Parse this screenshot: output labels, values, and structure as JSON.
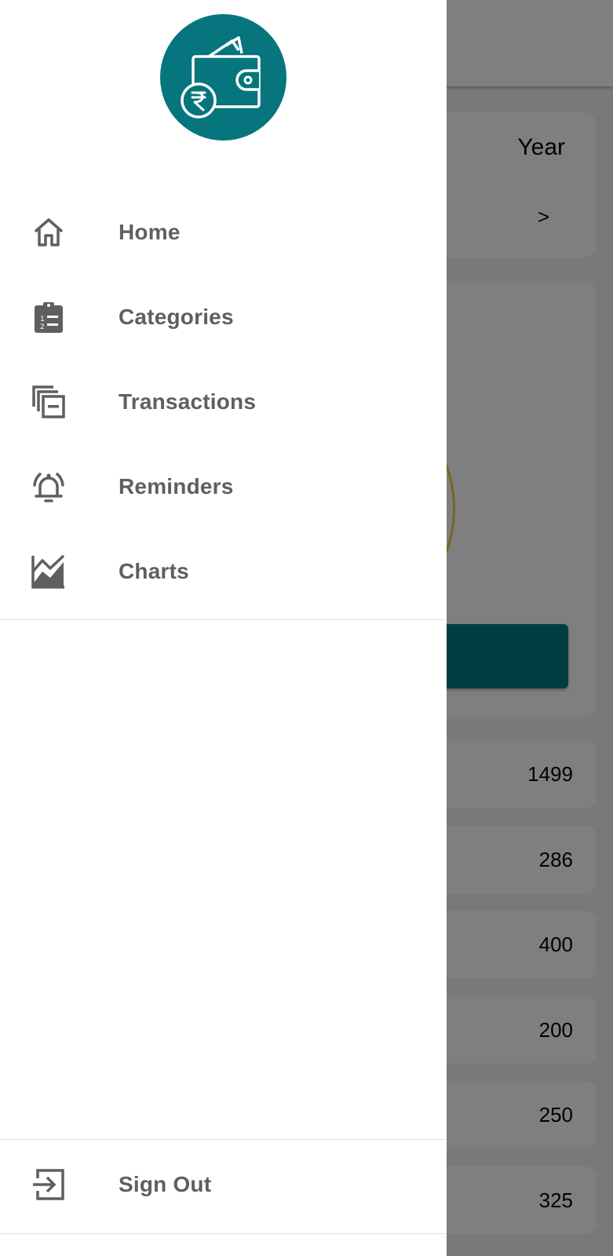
{
  "background": {
    "period_label": "Year",
    "period_next": ">",
    "rows": [
      "1499",
      "286",
      "400",
      "200",
      "250",
      "325"
    ]
  },
  "drawer": {
    "logo": {
      "icon": "wallet-rupee-icon",
      "color": "#06757d"
    },
    "items": [
      {
        "label": "Home",
        "icon": "home-icon"
      },
      {
        "label": "Categories",
        "icon": "clipboard-list-icon"
      },
      {
        "label": "Transactions",
        "icon": "stacked-cards-icon"
      },
      {
        "label": "Reminders",
        "icon": "bell-ringing-icon"
      },
      {
        "label": "Charts",
        "icon": "area-chart-icon"
      }
    ],
    "footer_item": {
      "label": "Sign Out",
      "icon": "sign-out-icon"
    }
  },
  "colors": {
    "accent": "#06757d",
    "label_text": "#5f5f5f",
    "icon": "#5f5f5f"
  }
}
